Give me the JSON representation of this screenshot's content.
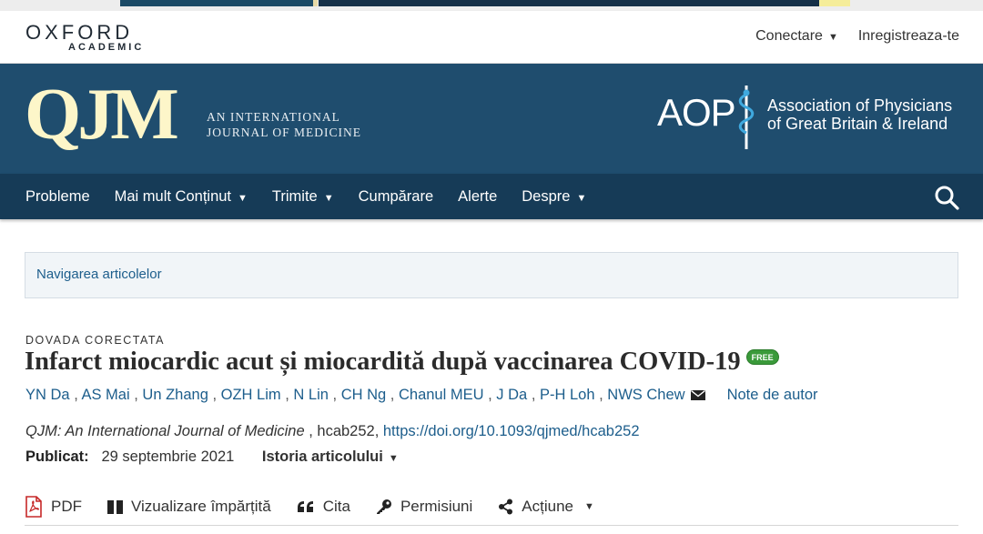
{
  "header": {
    "logo_word": "OXFORD",
    "logo_sub": "ACADEMIC",
    "login_label": "Conectare",
    "register_label": "Inregistreaza-te"
  },
  "journal": {
    "abbr": "QJM",
    "subtitle_line1": "AN INTERNATIONAL",
    "subtitle_line2": "JOURNAL OF MEDICINE",
    "partner_mark": "AOP",
    "partner_line1": "Association of Physicians",
    "partner_line2": "of Great Britain & Ireland"
  },
  "nav": {
    "items": [
      {
        "label": "Probleme",
        "dropdown": false
      },
      {
        "label": "Mai mult Conținut",
        "dropdown": true
      },
      {
        "label": "Trimite",
        "dropdown": true
      },
      {
        "label": "Cumpărare",
        "dropdown": false
      },
      {
        "label": "Alerte",
        "dropdown": false
      },
      {
        "label": "Despre",
        "dropdown": true
      }
    ],
    "caret": "▼"
  },
  "article_nav": {
    "label": "Navigarea articolelor"
  },
  "article": {
    "kicker": "DOVADA CORECTATA",
    "title": "Infarct miocardic acut și miocardită după vaccinarea COVID-19",
    "free_badge": "FREE",
    "authors": [
      "YN Da",
      "AS Mai",
      "Un Zhang",
      "OZH Lim",
      "N Lin",
      "CH Ng",
      "Chanul MEU",
      "J Da",
      "P-H Loh",
      "NWS Chew"
    ],
    "author_sep": " , ",
    "author_notes": "Note de autor",
    "journal_name": "QJM: An International Journal of Medicine",
    "citation_mid": " , hcab252, ",
    "doi": "https://doi.org/10.1093/qjmed/hcab252",
    "published_label": "Publicat:",
    "published_date": "29 septembrie 2021",
    "history_label": "Istoria articolului",
    "caret": "▼"
  },
  "toolbar": {
    "pdf": "PDF",
    "split_view": "Vizualizare împărțită",
    "cite": "Cita",
    "permissions": "Permisiuni",
    "actions": "Acțiune",
    "caret": "▼"
  },
  "colors": {
    "banner": "#1f4d6e",
    "nav": "#163b57",
    "link": "#1d5e8c",
    "qjm_logo": "#fdf6c9",
    "free_badge": "#3a9a3a"
  }
}
